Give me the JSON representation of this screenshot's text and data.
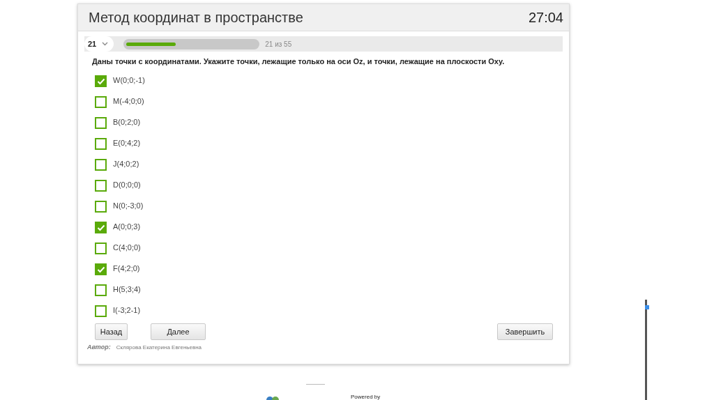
{
  "header": {
    "title": "Метод координат в пространстве",
    "timer": "27:04"
  },
  "progress": {
    "question_number": "21",
    "level": 0.38,
    "counter": "21 из 55"
  },
  "question": "Даны точки с координатами. Укажите точки, лежащие только на оси Oz, и точки, лежащие на плоскости Oxy.",
  "options": [
    {
      "label": "W(0;0;-1)",
      "checked": true
    },
    {
      "label": "M(-4;0;0)",
      "checked": false
    },
    {
      "label": "B(0;2;0)",
      "checked": false
    },
    {
      "label": "E(0;4;2)",
      "checked": false
    },
    {
      "label": "J(4;0;2)",
      "checked": false
    },
    {
      "label": "D(0;0;0)",
      "checked": false
    },
    {
      "label": "N(0;-3;0)",
      "checked": false
    },
    {
      "label": "A(0;0;3)",
      "checked": true
    },
    {
      "label": "C(4;0;0)",
      "checked": false
    },
    {
      "label": "F(4;2;0)",
      "checked": true
    },
    {
      "label": "H(5;3;4)",
      "checked": false
    },
    {
      "label": "I(-3;2-1)",
      "checked": false
    }
  ],
  "buttons": {
    "back": "Назад",
    "next": "Далее",
    "finish": "Завершить"
  },
  "author": {
    "label": "Автор:",
    "name": "Склярова Екатерина Евгеньевна"
  },
  "footer": {
    "powered_by": "Powered by"
  }
}
